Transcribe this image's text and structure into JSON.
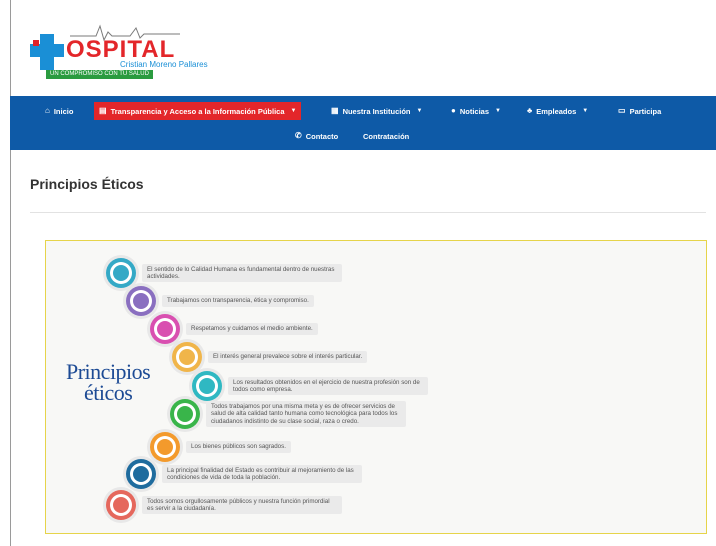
{
  "logo": {
    "word": "OSPITAL",
    "subtitle": "Cristian Moreno Pallares",
    "slogan": "UN COMPROMISO CON TU SALUD"
  },
  "nav": {
    "row1": [
      {
        "icon": "home-icon",
        "glyph": "⌂",
        "label": "Inicio",
        "dropdown": false,
        "active": false
      },
      {
        "icon": "document-icon",
        "glyph": "▤",
        "label": "Transparencia y Acceso a la Información Pública",
        "dropdown": true,
        "active": true
      },
      {
        "icon": "building-icon",
        "glyph": "▦",
        "label": "Nuestra Institución",
        "dropdown": true,
        "active": false
      },
      {
        "icon": "info-icon",
        "glyph": "●",
        "label": "Noticias",
        "dropdown": true,
        "active": false
      },
      {
        "icon": "users-icon",
        "glyph": "♣",
        "label": "Empleados",
        "dropdown": true,
        "active": false
      },
      {
        "icon": "card-icon",
        "glyph": "▭",
        "label": "Participa",
        "dropdown": false,
        "active": false
      }
    ],
    "row2": [
      {
        "icon": "phone-icon",
        "glyph": "✆",
        "label": "Contacto",
        "dropdown": false,
        "active": false
      },
      {
        "icon": "",
        "glyph": "",
        "label": "Contratación",
        "dropdown": false,
        "active": false
      }
    ],
    "active_color": "#e3262a",
    "bar_color": "#0e5aa7"
  },
  "page": {
    "title": "Principios Éticos"
  },
  "infographic": {
    "title_line1": "Principios",
    "title_line2": "éticos",
    "principles": [
      {
        "text": "El sentido de lo Calidad Humana es fundamental dentro de nuestras actividades.",
        "color": "#34a9c6"
      },
      {
        "text": "Trabajamos con transparencia, ética y compromiso.",
        "color": "#8a6fc0"
      },
      {
        "text": "Respetamos y cuidamos el medio ambiente.",
        "color": "#d94fb0"
      },
      {
        "text": "El interés general prevalece sobre el interés particular.",
        "color": "#f0b54a"
      },
      {
        "text": "Los resultados obtenidos en el ejercicio de nuestra profesión son de todos como empresa.",
        "color": "#2fb8c2"
      },
      {
        "text": "Todos trabajamos por una misma meta y es de ofrecer servicios de salud de alta calidad tanto humana como tecnológica para todos los ciudadanos indistinto de su clase social, raza o credo.",
        "color": "#39b54a"
      },
      {
        "text": "Los bienes públicos son sagrados.",
        "color": "#f39a2c"
      },
      {
        "text": "La principal finalidad del Estado es contribuir al mejoramiento de las condiciones de vida de toda la población.",
        "color": "#1f6c9e"
      },
      {
        "text": "Todos somos orgullosamente públicos y nuestra función primordial es servir a la ciudadanía.",
        "color": "#e5685d"
      }
    ]
  }
}
